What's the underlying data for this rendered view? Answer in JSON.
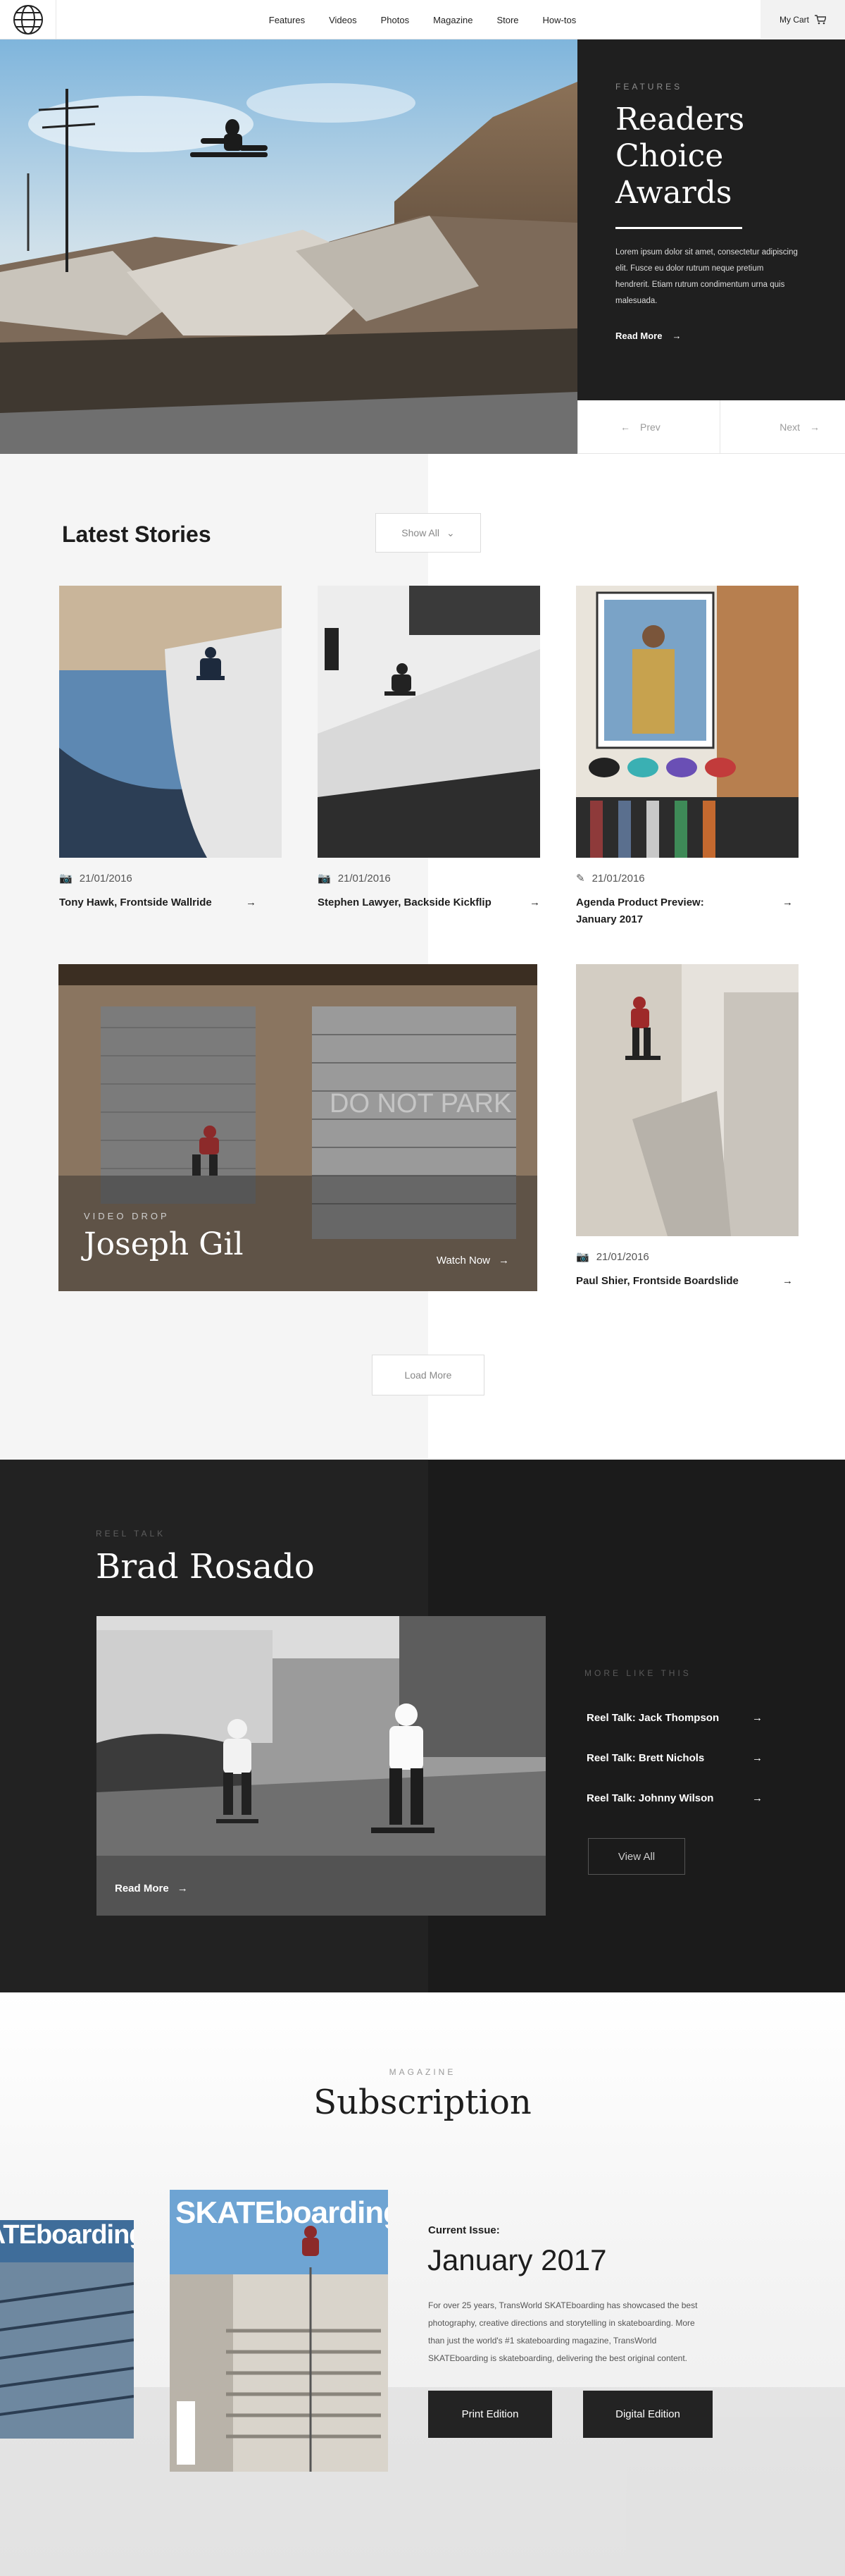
{
  "nav": {
    "items": [
      "Features",
      "Videos",
      "Photos",
      "Magazine",
      "Store",
      "How-tos"
    ],
    "cart_label": "My Cart"
  },
  "hero": {
    "eyebrow": "FEATURES",
    "title": "Readers Choice Awards",
    "body": "Lorem ipsum dolor sit amet, consectetur adipiscing elit. Fusce eu dolor rutrum neque pretium hendrerit. Etiam rutrum condimentum urna quis malesuada.",
    "read_more": "Read More",
    "prev": "Prev",
    "next": "Next"
  },
  "stories": {
    "heading": "Latest Stories",
    "show_all": "Show All",
    "cards": [
      {
        "date": "21/01/2016",
        "title": "Tony Hawk, Frontside Wallride",
        "icon": "camera-icon"
      },
      {
        "date": "21/01/2016",
        "title": "Stephen Lawyer, Backside Kickflip",
        "icon": "camera-icon"
      },
      {
        "date": "21/01/2016",
        "title": "Agenda Product Preview: January 2017",
        "icon": "pencil-icon"
      },
      {
        "date": "21/01/2016",
        "title": "Paul Shier, Frontside Boardslide",
        "icon": "camera-icon"
      }
    ],
    "feature": {
      "eyebrow": "VIDEO DROP",
      "name": "Joseph Gil",
      "cta": "Watch Now",
      "wall_text": "DO NOT PARK"
    },
    "load_more": "Load More"
  },
  "reel": {
    "eyebrow": "REEL TALK",
    "title": "Brad Rosado",
    "read_more": "Read More",
    "more_eyebrow": "MORE LIKE THIS",
    "links": [
      "Reel Talk: Jack Thompson",
      "Reel Talk: Brett Nichols",
      "Reel Talk: Johnny Wilson"
    ],
    "view_all": "View All"
  },
  "subscription": {
    "eyebrow": "MAGAZINE",
    "title": "Subscription",
    "current_label": "Current Issue:",
    "current_issue": "January 2017",
    "body": "For over 25 years, TransWorld SKATEboarding has showcased the best photography, creative directions and storytelling in skateboarding. More than just the world's #1 skateboarding magazine, TransWorld SKATEboarding is skateboarding, delivering the best original content.",
    "print_btn": "Print Edition",
    "digital_btn": "Digital Edition",
    "cover_masthead": "SKATEboarding"
  },
  "colors": {
    "dark": "#1f1f1f",
    "muted": "#8d8d8d",
    "light_bg": "#f5f5f5"
  }
}
